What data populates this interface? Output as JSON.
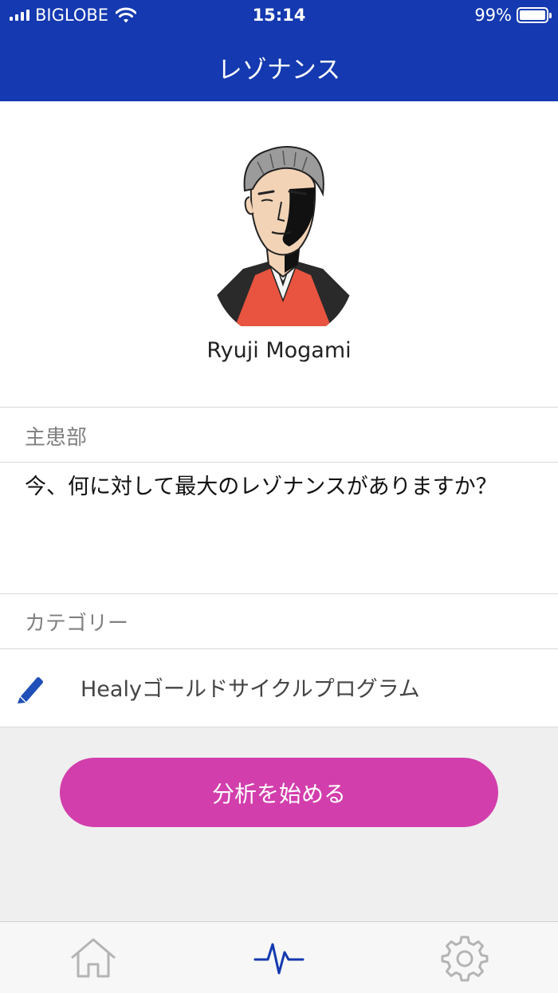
{
  "status_bar": {
    "carrier": "BIGLOBE",
    "time": "15:14",
    "battery_percent": "99%",
    "battery_level": 0.99,
    "icons": [
      "signal-icon",
      "wifi-icon",
      "battery-icon"
    ]
  },
  "nav": {
    "title": "レゾナンス"
  },
  "profile": {
    "name": "Ryuji Mogami",
    "avatar_icon": "portrait-avatar"
  },
  "focus": {
    "label": "主患部",
    "question": "今、何に対して最大のレゾナンスがありますか？"
  },
  "category": {
    "label": "カテゴリー",
    "program": "Healyゴールドサイクルプログラム",
    "icon": "pencil-icon"
  },
  "action": {
    "start_label": "分析を始める"
  },
  "tabs": [
    {
      "name": "home",
      "icon": "home-icon",
      "active": false
    },
    {
      "name": "analysis",
      "icon": "pulse-icon",
      "active": true
    },
    {
      "name": "settings",
      "icon": "gear-icon",
      "active": false
    }
  ],
  "colors": {
    "header": "#1439b0",
    "accent_button": "#d23eac",
    "active_tab": "#1439b0",
    "inactive_tab": "#b4b4b4",
    "pencil": "#1f4fb8"
  }
}
